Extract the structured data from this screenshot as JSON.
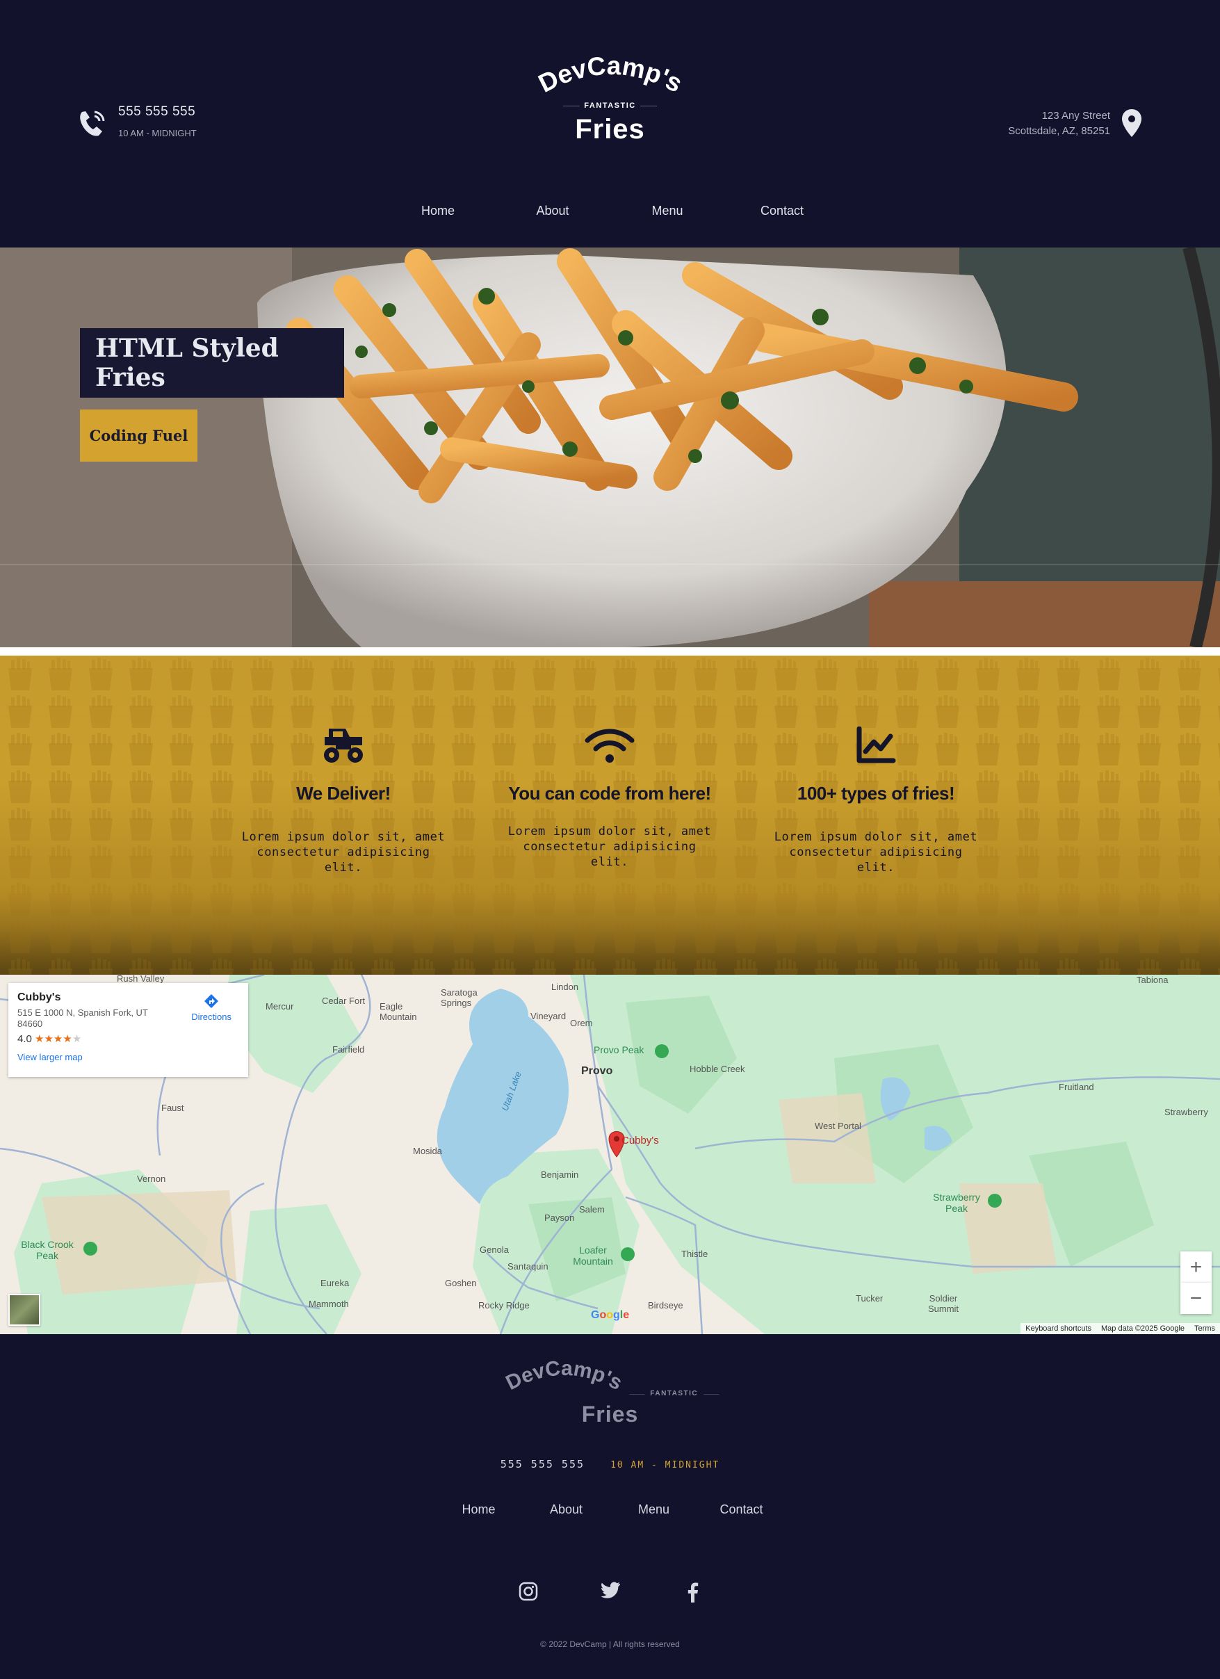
{
  "header": {
    "phone": "555 555 555",
    "hours": "10 AM - MIDNIGHT",
    "address_line1": "123 Any Street",
    "address_line2": "Scottsdale, AZ, 85251",
    "logo": {
      "top": "DevCamp's",
      "middle": "FANTASTIC",
      "bottom": "Fries"
    }
  },
  "nav": {
    "items": [
      "Home",
      "About",
      "Menu",
      "Contact"
    ]
  },
  "hero": {
    "title": "HTML Styled Fries",
    "button": "Coding Fuel"
  },
  "features": [
    {
      "icon": "monster-truck-icon",
      "title": "We Deliver!",
      "text": "Lorem ipsum dolor sit, amet consectetur adipisicing elit."
    },
    {
      "icon": "wifi-icon",
      "title": "You can code from here!",
      "text": "Lorem ipsum dolor sit, amet consectetur adipisicing elit."
    },
    {
      "icon": "chart-line-icon",
      "title": "100+ types of fries!",
      "text": "Lorem ipsum dolor sit, amet consectetur adipisicing elit."
    }
  ],
  "map": {
    "place_name": "Cubby's",
    "place_address": "515 E 1000 N, Spanish Fork, UT 84660",
    "rating": "4.0",
    "rating_stars": 4,
    "view_larger": "View larger map",
    "directions": "Directions",
    "marker_label": "Cubby's",
    "zoom_in": "+",
    "zoom_out": "−",
    "footer_items": [
      "Keyboard shortcuts",
      "Map data ©2025 Google",
      "Terms"
    ],
    "google": "Google",
    "labels": {
      "rush_valley": "Rush Valley",
      "tabiona": "Tabiona",
      "mercur": "Mercur",
      "cedar_fort": "Cedar Fort",
      "eagle_mountain": "Eagle Mountain",
      "saratoga_springs": "Saratoga Springs",
      "lindon": "Lindon",
      "vineyard": "Vineyard",
      "orem": "Orem",
      "provo_peak": "Provo Peak",
      "provo": "Provo",
      "hobble_creek": "Hobble Creek",
      "fairfield": "Fairfield",
      "utah_lake": "Utah Lake",
      "fruitland": "Fruitland",
      "strawberry": "Strawberry",
      "faust": "Faust",
      "west_portal": "West Portal",
      "mosida": "Mosida",
      "vernon": "Vernon",
      "benjamin": "Benjamin",
      "strawberry_peak": "Strawberry Peak",
      "salem": "Salem",
      "payson": "Payson",
      "black_crook_peak": "Black Crook Peak",
      "genola": "Genola",
      "loafer_mountain": "Loafer Mountain",
      "thistle": "Thistle",
      "santaquin": "Santaquin",
      "eureka": "Eureka",
      "goshen": "Goshen",
      "mammoth": "Mammoth",
      "rocky_ridge": "Rocky Ridge",
      "birdseye": "Birdseye",
      "tucker": "Tucker",
      "soldier_summit": "Soldier Summit"
    }
  },
  "footer": {
    "phone": "555 555 555",
    "hours": "10 AM - MIDNIGHT",
    "nav": [
      "Home",
      "About",
      "Menu",
      "Contact"
    ],
    "social": [
      "instagram-icon",
      "twitter-icon",
      "facebook-icon"
    ],
    "copyright": "© 2022 DevCamp | All rights reserved"
  },
  "colors": {
    "navy": "#12122d",
    "gold": "#d4a22f",
    "hero_title_bg": "#181833"
  }
}
